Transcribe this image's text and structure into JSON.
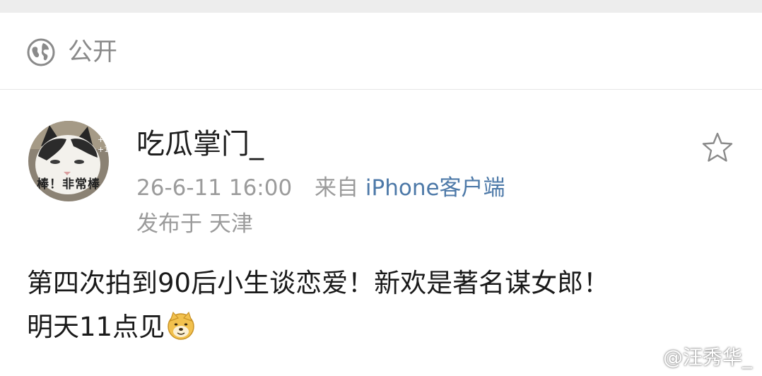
{
  "visibility": {
    "icon": "globe-icon",
    "label": "公开"
  },
  "post": {
    "avatar_text": "棒！非常棒",
    "username": "吃瓜掌门_",
    "timestamp": "26-6-11 16:00",
    "source_prefix": "来自",
    "source_app": "iPhone客户端",
    "location_prefix": "发布于",
    "location": "天津",
    "text_line1": "第四次拍到90后小生谈恋爱！新欢是著名谋女郎！",
    "text_line2": "明天11点见",
    "emoji": "doge-emoji",
    "favorite_icon": "star-icon"
  },
  "watermark": {
    "icon": "weibo-logo-icon",
    "text": "@汪秀华_"
  },
  "colors": {
    "link": "#4d79a8",
    "meta": "#9b9b9b",
    "top_strip": "#ededed"
  }
}
